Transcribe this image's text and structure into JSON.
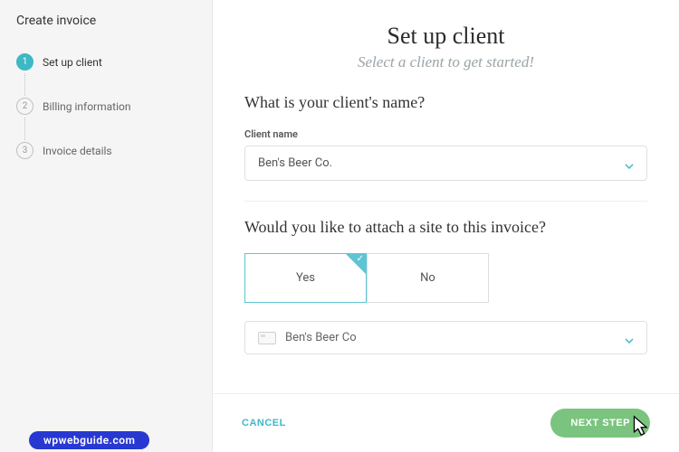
{
  "sidebar": {
    "title": "Create invoice",
    "steps": [
      {
        "num": "1",
        "label": "Set up client",
        "active": true
      },
      {
        "num": "2",
        "label": "Billing information",
        "active": false
      },
      {
        "num": "3",
        "label": "Invoice details",
        "active": false
      }
    ]
  },
  "main": {
    "title": "Set up client",
    "subtitle": "Select a client to get started!",
    "client_heading": "What is your client's name?",
    "client_field_label": "Client name",
    "client_select_value": "Ben's Beer Co.",
    "attach_heading": "Would you like to attach a site to this invoice?",
    "options": {
      "yes": "Yes",
      "no": "No",
      "selected": "yes"
    },
    "site_select_value": "Ben's Beer Co"
  },
  "footer": {
    "cancel": "CANCEL",
    "next": "NEXT STEP"
  },
  "watermark": "wpwebguide.com",
  "colors": {
    "accent_teal": "#3db9c5",
    "accent_green": "#7bc47f",
    "brand_pill": "#2838d1"
  }
}
